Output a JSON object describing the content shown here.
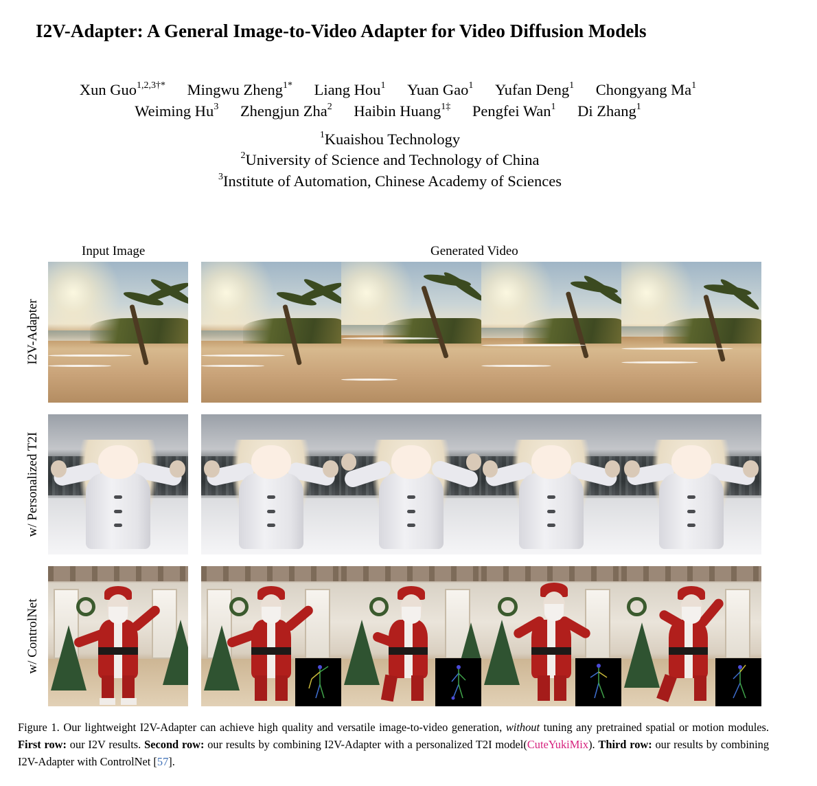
{
  "paper": {
    "title": "I2V-Adapter: A General Image-to-Video Adapter for Video Diffusion Models",
    "authors_line1": [
      {
        "name": "Xun Guo",
        "sup": "1,2,3†*"
      },
      {
        "name": "Mingwu Zheng",
        "sup": "1*"
      },
      {
        "name": "Liang Hou",
        "sup": "1"
      },
      {
        "name": "Yuan Gao",
        "sup": "1"
      },
      {
        "name": "Yufan Deng",
        "sup": "1"
      },
      {
        "name": "Chongyang Ma",
        "sup": "1"
      }
    ],
    "authors_line2": [
      {
        "name": "Weiming Hu",
        "sup": "3"
      },
      {
        "name": "Zhengjun Zha",
        "sup": "2"
      },
      {
        "name": "Haibin Huang",
        "sup": "1‡"
      },
      {
        "name": "Pengfei Wan",
        "sup": "1"
      },
      {
        "name": "Di Zhang",
        "sup": "1"
      }
    ],
    "affiliations": [
      {
        "sup": "1",
        "name": "Kuaishou Technology"
      },
      {
        "sup": "2",
        "name": "University of Science and Technology of China"
      },
      {
        "sup": "3",
        "name": "Institute of Automation, Chinese Academy of Sciences"
      }
    ]
  },
  "figure": {
    "col_input": "Input Image",
    "col_generated": "Generated Video",
    "row_labels": [
      "I2V-Adapter",
      "w/ Personalized T2I",
      "w/ ControlNet"
    ],
    "caption": {
      "lead": "Figure 1.  Our lightweight I2V-Adapter can achieve high quality and versatile image-to-video generation, ",
      "em": "without",
      "p1": " tuning any pretrained spatial or motion modules.  ",
      "b1": "First row:",
      "p2": " our I2V results.  ",
      "b2": "Second row:",
      "p3": " our results by combining I2V-Adapter with a personalized T2I model(",
      "link1": "CuteYukiMix",
      "p4": "). ",
      "b3": "Third row:",
      "p5": " our results by combining I2V-Adapter with ControlNet [",
      "cite": "57",
      "p6": "]."
    }
  }
}
